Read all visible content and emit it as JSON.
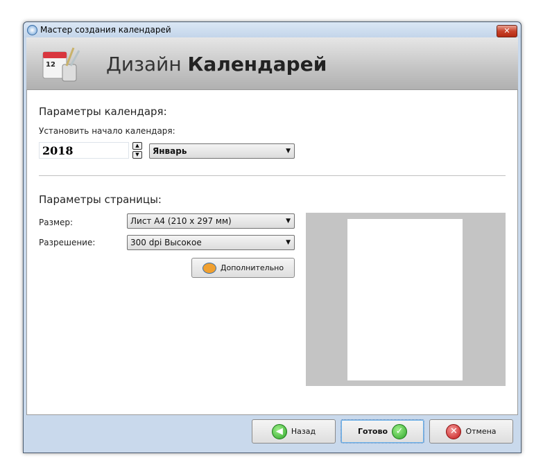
{
  "window": {
    "title": "Мастер создания календарей",
    "close_label": "✕"
  },
  "header": {
    "title_light": "Дизайн",
    "title_bold": "Календарей"
  },
  "calendar": {
    "heading": "Параметры календаря:",
    "start_label": "Установить начало календаря:",
    "year": "2018",
    "month": "Январь"
  },
  "page": {
    "heading": "Параметры страницы:",
    "size_label": "Размер:",
    "size_value": "Лист A4 (210 x 297 мм)",
    "resolution_label": "Разрешение:",
    "resolution_value": "300 dpi Высокое",
    "advanced_button": "Дополнительно"
  },
  "footer": {
    "back": "Назад",
    "done": "Готово",
    "cancel": "Отмена"
  }
}
